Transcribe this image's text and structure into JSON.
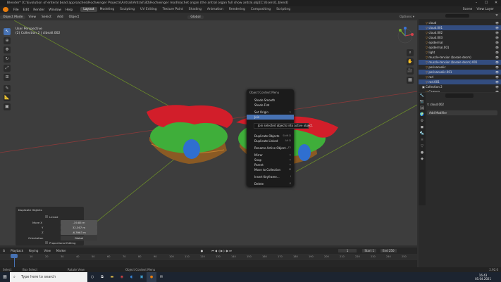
{
  "window": {
    "title": "Blender* [C:\\Evolution of enteral bead approaches\\Hochwinger Projects\\Antrail\\Antrail\\3D\\Hochwinger mod\\nachet organ (the antral organ full show antral.obj][C:\\Users\\1.blend]"
  },
  "menus": [
    "File",
    "Edit",
    "Render",
    "Window",
    "Help"
  ],
  "workspaces": [
    "Layout",
    "Modeling",
    "Sculpting",
    "UV Editing",
    "Texture Paint",
    "Shading",
    "Animation",
    "Rendering",
    "Compositing",
    "Scripting"
  ],
  "scene": {
    "label": "Scene",
    "view_layer": "View Layer"
  },
  "viewport": {
    "mode": "Object Mode",
    "menus": [
      "View",
      "Select",
      "Add",
      "Object"
    ],
    "transform": "Global",
    "perspective": "User Perspective",
    "collection": "(2) Collection 2 | clbeall.002"
  },
  "context_menu": {
    "title": "Object Context Menu",
    "items": [
      {
        "label": "Shade Smooth",
        "shortcut": ""
      },
      {
        "label": "Shade Flat",
        "shortcut": ""
      },
      {
        "label": "Set Origin",
        "shortcut": "▸"
      },
      {
        "label": "Join",
        "shortcut": ""
      },
      {
        "label": "Duplicate Objects",
        "shortcut": "Shift D"
      },
      {
        "label": "Duplicate Linked",
        "shortcut": "Alt D"
      },
      {
        "label": "Rename Active Object...",
        "shortcut": "F2"
      },
      {
        "label": "Mirror",
        "shortcut": "▸"
      },
      {
        "label": "Snap",
        "shortcut": "▸"
      },
      {
        "label": "Parent",
        "shortcut": "▸"
      },
      {
        "label": "Move to Collection",
        "shortcut": "M"
      },
      {
        "label": "Insert Keyframe...",
        "shortcut": "I"
      },
      {
        "label": "Delete",
        "shortcut": "X"
      }
    ],
    "tooltip": "Join selected objects into active object."
  },
  "redo_panel": {
    "title": "Duplicate Objects",
    "linked_label": "Linked",
    "move": [
      {
        "axis": "Move X",
        "value": "-19.85 m"
      },
      {
        "axis": "Y",
        "value": "32.367 m"
      },
      {
        "axis": "Z",
        "value": "-6.3963 m"
      }
    ],
    "orientation_label": "Orientation",
    "orientation_value": "Global",
    "proportional": "Proportional Editing"
  },
  "timeline": {
    "menus": [
      "Playback",
      "Keying",
      "View",
      "Marker"
    ],
    "current_frame": "1",
    "start_label": "Start",
    "start": "1",
    "end_label": "End",
    "end": "250",
    "ticks": [
      "0",
      "10",
      "20",
      "30",
      "40",
      "50",
      "60",
      "70",
      "80",
      "90",
      "100",
      "110",
      "120",
      "130",
      "140",
      "150",
      "160",
      "170",
      "180",
      "190",
      "200",
      "210",
      "220",
      "230",
      "240",
      "250"
    ]
  },
  "statusbar": {
    "select": "Select",
    "box": "Box Select",
    "rotate": "Rotate View",
    "menu": "Object Context Menu",
    "version": "2.92.0"
  },
  "outliner": {
    "rows": [
      {
        "name": "cloud",
        "sel": false,
        "indent": 2
      },
      {
        "name": "cloud.001",
        "sel": true,
        "indent": 2
      },
      {
        "name": "cloud.002",
        "sel": false,
        "indent": 2
      },
      {
        "name": "cloud.003",
        "sel": false,
        "indent": 2
      },
      {
        "name": "epidermal",
        "sel": false,
        "indent": 2
      },
      {
        "name": "epidermal.001",
        "sel": false,
        "indent": 2
      },
      {
        "name": "light",
        "sel": false,
        "indent": 2
      },
      {
        "name": "muscle-tension (bosale decm)",
        "sel": false,
        "indent": 2
      },
      {
        "name": "muscle-tension (bosale decm).001",
        "sel": true,
        "indent": 2
      },
      {
        "name": "perivacuolic",
        "sel": false,
        "indent": 2
      },
      {
        "name": "perivacuolic.001",
        "sel": true,
        "indent": 2
      },
      {
        "name": "rod",
        "sel": false,
        "indent": 2
      },
      {
        "name": "rod.001",
        "sel": true,
        "indent": 2
      },
      {
        "name": "Collection 2",
        "sel": false,
        "indent": 1
      },
      {
        "name": "Camera",
        "sel": false,
        "indent": 2
      }
    ]
  },
  "properties": {
    "object": "cloud.002",
    "add_modifier": "Add Modifier"
  },
  "taskbar": {
    "search": "Type here to search",
    "time": "16:43",
    "date": "05.04.2021"
  }
}
